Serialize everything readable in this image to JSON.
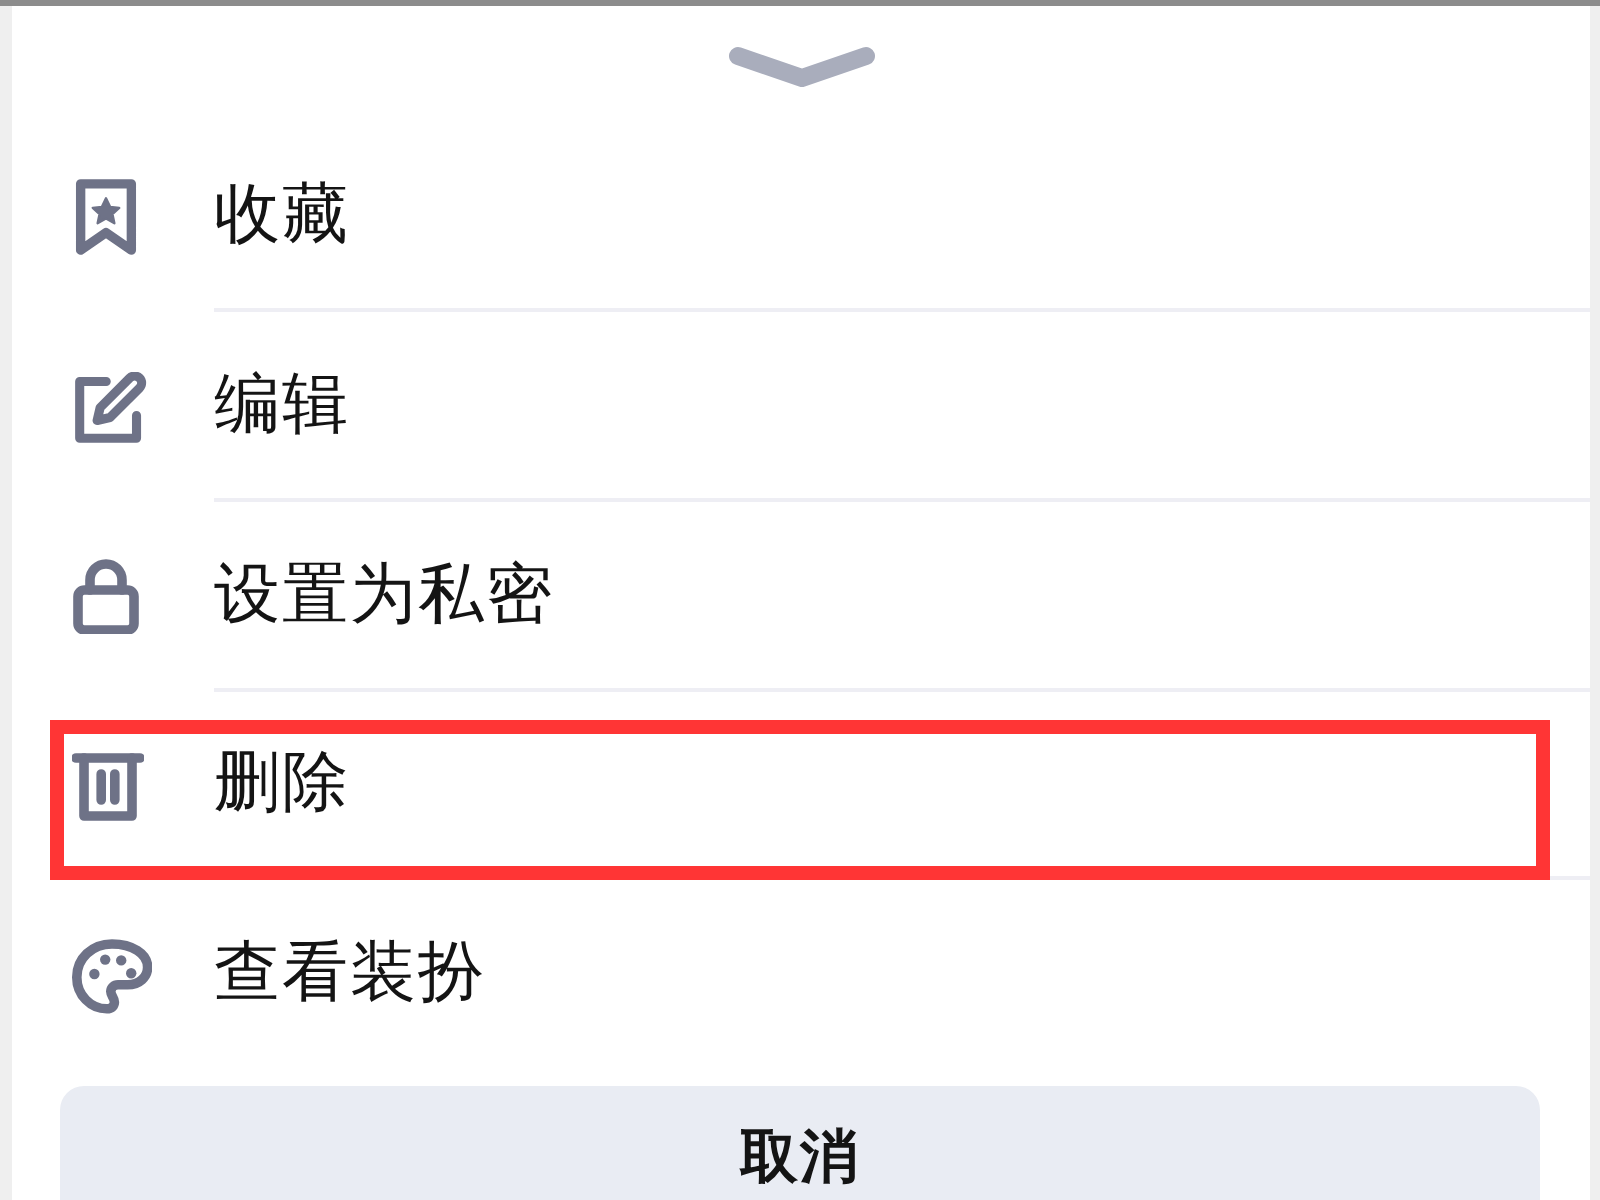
{
  "menu": {
    "items": [
      {
        "kind": "bookmark",
        "label": "收藏",
        "highlighted": false
      },
      {
        "kind": "edit",
        "label": "编辑",
        "highlighted": false
      },
      {
        "kind": "lock",
        "label": "设置为私密",
        "highlighted": false
      },
      {
        "kind": "trash",
        "label": "删除",
        "highlighted": true
      },
      {
        "kind": "palette",
        "label": "查看装扮",
        "highlighted": false
      }
    ]
  },
  "cancel_button": {
    "label": "取消"
  }
}
